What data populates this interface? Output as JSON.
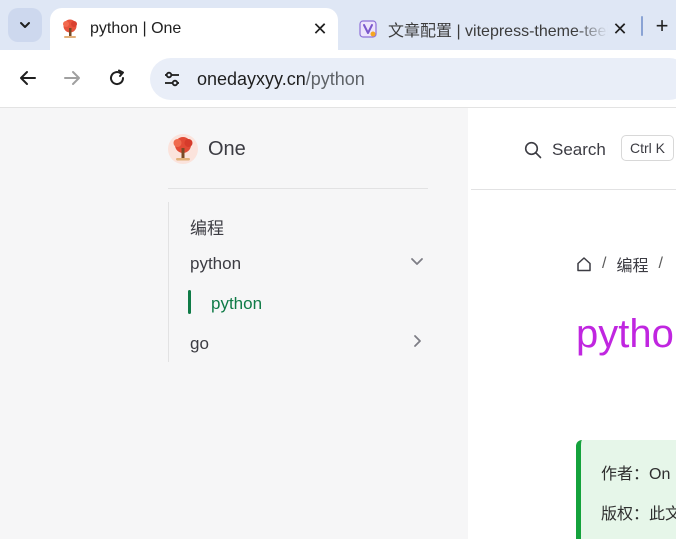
{
  "browser": {
    "tabs": [
      {
        "title": "python | One",
        "favicon": "tree-favicon",
        "active": true
      },
      {
        "title": "文章配置 | vitepress-theme-teek",
        "favicon": "teek-favicon",
        "active": false
      }
    ],
    "close_glyph": "✕",
    "newtab_glyph": "+",
    "url_host": "onedayxyy.cn",
    "url_path": "/python"
  },
  "site": {
    "brand": "One",
    "search_label": "Search",
    "search_kbd": "Ctrl K"
  },
  "sidebar": {
    "section": "编程",
    "items": [
      {
        "label": "python",
        "expanded": true,
        "children": [
          {
            "label": "python",
            "active": true
          }
        ]
      },
      {
        "label": "go",
        "expanded": false
      }
    ]
  },
  "content": {
    "breadcrumb": [
      "编程"
    ],
    "breadcrumb_sep": "/",
    "title": "pytho",
    "info": {
      "author": "作者：On",
      "copyright": "版权：此文"
    }
  },
  "colors": {
    "accent_green": "#0f7b47",
    "title_purple": "#c026e0",
    "info_border": "#14a23c"
  }
}
